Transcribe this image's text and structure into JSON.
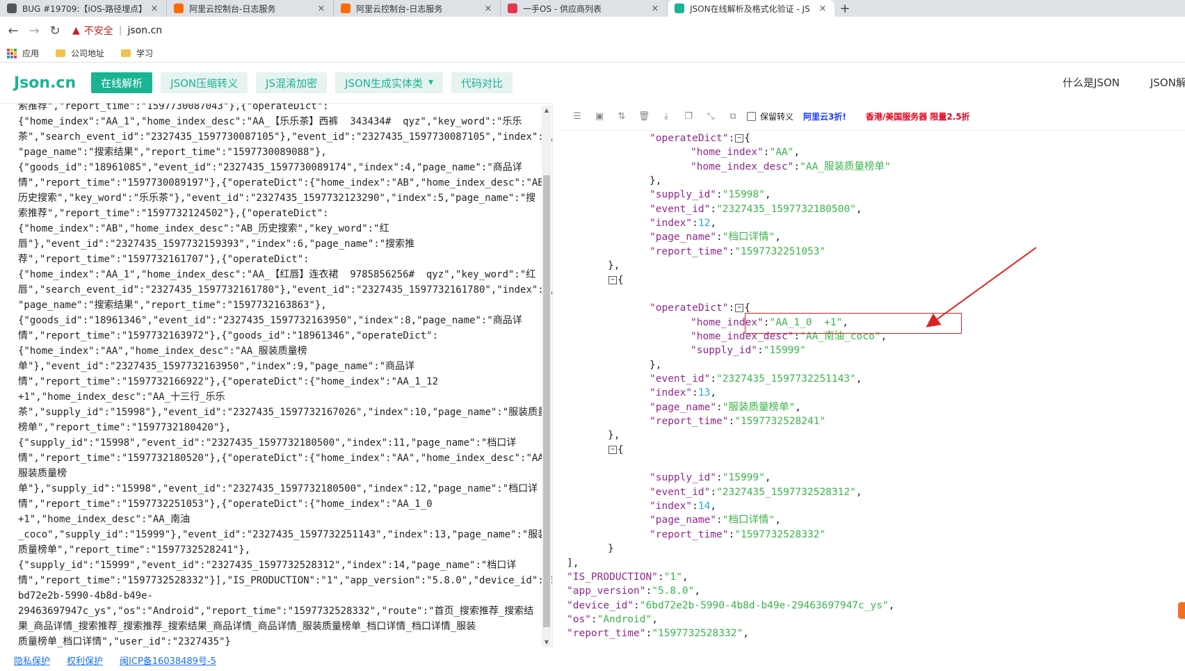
{
  "browser": {
    "tabs": [
      {
        "title": "BUG #19709:【iOS-路径埋点】",
        "favicon": "bug-icon",
        "color": "#555555"
      },
      {
        "title": "阿里云控制台-日志服务",
        "favicon": "aliyun-icon",
        "color": "#ff6a00"
      },
      {
        "title": "阿里云控制台-日志服务",
        "favicon": "aliyun-icon",
        "color": "#ff6a00"
      },
      {
        "title": "一手OS - 供应商列表",
        "favicon": "app-icon",
        "color": "#e8344e"
      },
      {
        "title": "JSON在线解析及格式化验证 - JS",
        "favicon": "json-icon",
        "color": "#1ab394"
      }
    ],
    "security_label": "不安全",
    "url": "json.cn",
    "bookmarks": [
      "应用",
      "公司地址",
      "学习"
    ]
  },
  "site": {
    "logo_main": "Json",
    "logo_tld": ".cn",
    "nav": [
      "在线解析",
      "JSON压缩转义",
      "JS混淆加密",
      "JSON生成实体类",
      "代码对比"
    ],
    "right_links": [
      "什么是JSON",
      "JSON解"
    ]
  },
  "left_editor": {
    "lines": [
      "索推荐\",\"report_time\":\"1597730087043\"},{\"operateDict\":",
      "{\"home_index\":\"AA_1\",\"home_index_desc\":\"AA_【乐乐茶】西裤  343434#  qyz\",\"key_word\":\"乐乐",
      "茶\",\"search_event_id\":\"2327435_1597730087105\"},\"event_id\":\"2327435_1597730087105\",\"index\":3,",
      "\"page_name\":\"搜索结果\",\"report_time\":\"1597730089088\"},",
      "{\"goods_id\":\"18961085\",\"event_id\":\"2327435_1597730089174\",\"index\":4,\"page_name\":\"商品详",
      "情\",\"report_time\":\"1597730089197\"},{\"operateDict\":{\"home_index\":\"AB\",\"home_index_desc\":\"AB_",
      "历史搜索\",\"key_word\":\"乐乐茶\"},\"event_id\":\"2327435_1597732123290\",\"index\":5,\"page_name\":\"搜",
      "索推荐\",\"report_time\":\"1597732124502\"},{\"operateDict\":",
      "{\"home_index\":\"AB\",\"home_index_desc\":\"AB_历史搜索\",\"key_word\":\"红",
      "唇\"},\"event_id\":\"2327435_1597732159393\",\"index\":6,\"page_name\":\"搜索推",
      "荐\",\"report_time\":\"1597732161707\"},{\"operateDict\":",
      "{\"home_index\":\"AA_1\",\"home_index_desc\":\"AA_【红唇】连衣裙  9785856256#  qyz\",\"key_word\":\"红",
      "唇\",\"search_event_id\":\"2327435_1597732161780\"},\"event_id\":\"2327435_1597732161780\",\"index\":7,",
      "\"page_name\":\"搜索结果\",\"report_time\":\"1597732163863\"},",
      "{\"goods_id\":\"18961346\",\"event_id\":\"2327435_1597732163950\",\"index\":8,\"page_name\":\"商品详",
      "情\",\"report_time\":\"1597732163972\"},{\"goods_id\":\"18961346\",\"operateDict\":",
      "{\"home_index\":\"AA\",\"home_index_desc\":\"AA_服装质量榜",
      "单\"},\"event_id\":\"2327435_1597732163950\",\"index\":9,\"page_name\":\"商品详",
      "情\",\"report_time\":\"1597732166922\"},{\"operateDict\":{\"home_index\":\"AA_1_12",
      "+1\",\"home_index_desc\":\"AA_十三行_乐乐",
      "茶\",\"supply_id\":\"15998\"},\"event_id\":\"2327435_1597732167026\",\"index\":10,\"page_name\":\"服装质量",
      "榜单\",\"report_time\":\"1597732180420\"},",
      "{\"supply_id\":\"15998\",\"event_id\":\"2327435_1597732180500\",\"index\":11,\"page_name\":\"档口详",
      "情\",\"report_time\":\"1597732180520\"},{\"operateDict\":{\"home_index\":\"AA\",\"home_index_desc\":\"AA_",
      "服装质量榜",
      "单\"},\"supply_id\":\"15998\",\"event_id\":\"2327435_1597732180500\",\"index\":12,\"page_name\":\"档口详",
      "情\",\"report_time\":\"1597732251053\"},{\"operateDict\":{\"home_index\":\"AA_1_0",
      "+1\",\"home_index_desc\":\"AA_南油",
      "_coco\",\"supply_id\":\"15999\"},\"event_id\":\"2327435_1597732251143\",\"index\":13,\"page_name\":\"服装",
      "质量榜单\",\"report_time\":\"1597732528241\"},",
      "{\"supply_id\":\"15999\",\"event_id\":\"2327435_1597732528312\",\"index\":14,\"page_name\":\"档口详",
      "情\",\"report_time\":\"1597732528332\"}],\"IS_PRODUCTION\":\"1\",\"app_version\":\"5.8.0\",\"device_id\":\"6",
      "bd72e2b-5990-4b8d-b49e-",
      "29463697947c_ys\",\"os\":\"Android\",\"report_time\":\"1597732528332\",\"route\":\"首页_搜索推荐_搜索结",
      "果_商品详情_搜索推荐_搜索推荐_搜索结果_商品详情_商品详情_服装质量榜单_档口详情_档口详情_服装",
      "质量榜单_档口详情\",\"user_id\":\"2327435\"}"
    ]
  },
  "right_toolbar": {
    "icons": [
      "database-icon",
      "excel-icon",
      "sort-icon",
      "trash-icon",
      "download-icon",
      "copy-icon",
      "compress-icon",
      "code-icon"
    ],
    "keep_escape_label": "保留转义",
    "promo1": "阿里云3折!",
    "promo2": "香港/美国服务器 限量2.5折"
  },
  "json_view": {
    "lines": [
      {
        "indent": 2,
        "tokens": [
          [
            "k",
            "\"operateDict\""
          ],
          [
            "p",
            ":"
          ],
          [
            "t",
            "⊟"
          ],
          [
            "p",
            "{"
          ]
        ]
      },
      {
        "indent": 3,
        "tokens": [
          [
            "k",
            "\"home_index\""
          ],
          [
            "p",
            ":"
          ],
          [
            "s",
            "\"AA\""
          ],
          [
            "p",
            ","
          ]
        ]
      },
      {
        "indent": 3,
        "tokens": [
          [
            "k",
            "\"home_index_desc\""
          ],
          [
            "p",
            ":"
          ],
          [
            "s",
            "\"AA_服装质量榜单\""
          ]
        ]
      },
      {
        "indent": 2,
        "tokens": [
          [
            "p",
            "},"
          ]
        ]
      },
      {
        "indent": 2,
        "tokens": [
          [
            "k",
            "\"supply_id\""
          ],
          [
            "p",
            ":"
          ],
          [
            "s",
            "\"15998\""
          ],
          [
            "p",
            ","
          ]
        ]
      },
      {
        "indent": 2,
        "tokens": [
          [
            "k",
            "\"event_id\""
          ],
          [
            "p",
            ":"
          ],
          [
            "s",
            "\"2327435_1597732180500\""
          ],
          [
            "p",
            ","
          ]
        ]
      },
      {
        "indent": 2,
        "tokens": [
          [
            "k",
            "\"index\""
          ],
          [
            "p",
            ":"
          ],
          [
            "n",
            "12"
          ],
          [
            "p",
            ","
          ]
        ]
      },
      {
        "indent": 2,
        "tokens": [
          [
            "k",
            "\"page_name\""
          ],
          [
            "p",
            ":"
          ],
          [
            "s",
            "\"档口详情\""
          ],
          [
            "p",
            ","
          ]
        ]
      },
      {
        "indent": 2,
        "tokens": [
          [
            "k",
            "\"report_time\""
          ],
          [
            "p",
            ":"
          ],
          [
            "s",
            "\"1597732251053\""
          ]
        ]
      },
      {
        "indent": 1,
        "tokens": [
          [
            "p",
            "},"
          ]
        ]
      },
      {
        "indent": 1,
        "tokens": [
          [
            "t",
            "⊟"
          ],
          [
            "p",
            "{"
          ]
        ]
      },
      {
        "indent": 1,
        "tokens": []
      },
      {
        "indent": 2,
        "tokens": [
          [
            "k",
            "\"operateDict\""
          ],
          [
            "p",
            ":"
          ],
          [
            "t",
            "⊟"
          ],
          [
            "p",
            "{"
          ]
        ]
      },
      {
        "indent": 3,
        "tokens": [
          [
            "k",
            "\"home_index\""
          ],
          [
            "p",
            ":"
          ],
          [
            "s",
            "\"AA_1_0  +1\""
          ],
          [
            "p",
            ","
          ]
        ]
      },
      {
        "indent": 3,
        "tokens": [
          [
            "k",
            "\"home_index_desc\""
          ],
          [
            "p",
            ":"
          ],
          [
            "s",
            "\"AA_南油_coco\""
          ],
          [
            "p",
            ","
          ]
        ]
      },
      {
        "indent": 3,
        "tokens": [
          [
            "k",
            "\"supply_id\""
          ],
          [
            "p",
            ":"
          ],
          [
            "s",
            "\"15999\""
          ]
        ]
      },
      {
        "indent": 2,
        "tokens": [
          [
            "p",
            "},"
          ]
        ]
      },
      {
        "indent": 2,
        "tokens": [
          [
            "k",
            "\"event_id\""
          ],
          [
            "p",
            ":"
          ],
          [
            "s",
            "\"2327435_1597732251143\""
          ],
          [
            "p",
            ","
          ]
        ]
      },
      {
        "indent": 2,
        "tokens": [
          [
            "k",
            "\"index\""
          ],
          [
            "p",
            ":"
          ],
          [
            "n",
            "13"
          ],
          [
            "p",
            ","
          ]
        ]
      },
      {
        "indent": 2,
        "tokens": [
          [
            "k",
            "\"page_name\""
          ],
          [
            "p",
            ":"
          ],
          [
            "s",
            "\"服装质量榜单\""
          ],
          [
            "p",
            ","
          ]
        ]
      },
      {
        "indent": 2,
        "tokens": [
          [
            "k",
            "\"report_time\""
          ],
          [
            "p",
            ":"
          ],
          [
            "s",
            "\"1597732528241\""
          ]
        ]
      },
      {
        "indent": 1,
        "tokens": [
          [
            "p",
            "},"
          ]
        ]
      },
      {
        "indent": 1,
        "tokens": [
          [
            "t",
            "⊟"
          ],
          [
            "p",
            "{"
          ]
        ]
      },
      {
        "indent": 1,
        "tokens": []
      },
      {
        "indent": 2,
        "tokens": [
          [
            "k",
            "\"supply_id\""
          ],
          [
            "p",
            ":"
          ],
          [
            "s",
            "\"15999\""
          ],
          [
            "p",
            ","
          ]
        ]
      },
      {
        "indent": 2,
        "tokens": [
          [
            "k",
            "\"event_id\""
          ],
          [
            "p",
            ":"
          ],
          [
            "s",
            "\"2327435_1597732528312\""
          ],
          [
            "p",
            ","
          ]
        ]
      },
      {
        "indent": 2,
        "tokens": [
          [
            "k",
            "\"index\""
          ],
          [
            "p",
            ":"
          ],
          [
            "n",
            "14"
          ],
          [
            "p",
            ","
          ]
        ]
      },
      {
        "indent": 2,
        "tokens": [
          [
            "k",
            "\"page_name\""
          ],
          [
            "p",
            ":"
          ],
          [
            "s",
            "\"档口详情\""
          ],
          [
            "p",
            ","
          ]
        ]
      },
      {
        "indent": 2,
        "tokens": [
          [
            "k",
            "\"report_time\""
          ],
          [
            "p",
            ":"
          ],
          [
            "s",
            "\"1597732528332\""
          ]
        ]
      },
      {
        "indent": 1,
        "tokens": [
          [
            "p",
            "}"
          ]
        ]
      },
      {
        "indent": 0,
        "tokens": [
          [
            "p",
            "],"
          ]
        ]
      },
      {
        "indent": 0,
        "tokens": [
          [
            "k",
            "\"IS_PRODUCTION\""
          ],
          [
            "p",
            ":"
          ],
          [
            "s",
            "\"1\""
          ],
          [
            "p",
            ","
          ]
        ]
      },
      {
        "indent": 0,
        "tokens": [
          [
            "k",
            "\"app_version\""
          ],
          [
            "p",
            ":"
          ],
          [
            "s",
            "\"5.8.0\""
          ],
          [
            "p",
            ","
          ]
        ]
      },
      {
        "indent": 0,
        "tokens": [
          [
            "k",
            "\"device_id\""
          ],
          [
            "p",
            ":"
          ],
          [
            "s",
            "\"6bd72e2b-5990-4b8d-b49e-29463697947c_ys\""
          ],
          [
            "p",
            ","
          ]
        ]
      },
      {
        "indent": 0,
        "tokens": [
          [
            "k",
            "\"os\""
          ],
          [
            "p",
            ":"
          ],
          [
            "s",
            "\"Android\""
          ],
          [
            "p",
            ","
          ]
        ]
      },
      {
        "indent": 0,
        "tokens": [
          [
            "k",
            "\"report_time\""
          ],
          [
            "p",
            ":"
          ],
          [
            "s",
            "\"1597732528332\""
          ],
          [
            "p",
            ","
          ]
        ]
      }
    ]
  },
  "footer": {
    "links": [
      "隐私保护",
      "权利保护",
      "闽ICP备16038489号-5"
    ]
  },
  "colors": {
    "brand": "#1ab394",
    "json_key": "#92278f",
    "json_string": "#3ab54a",
    "json_number": "#25aae1",
    "annotation": "#e02020"
  }
}
